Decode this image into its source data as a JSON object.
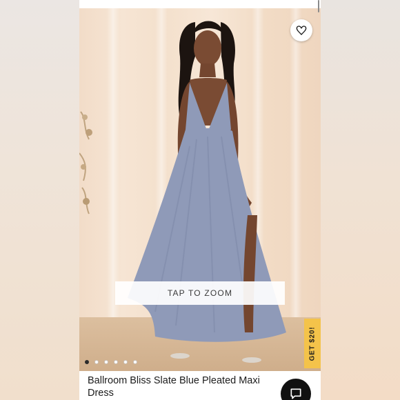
{
  "product": {
    "title": "Ballroom Bliss Slate Blue Pleated Maxi Dress",
    "image_alt": "Model wearing slate blue pleated maxi dress",
    "zoom_label": "TAP TO ZOOM",
    "promo_label": "GET $20!",
    "carousel": {
      "count": 6,
      "active_index": 0
    }
  },
  "icons": {
    "favorite": "heart-icon",
    "chat": "chat-icon"
  },
  "colors": {
    "dress": "#8f9ab8",
    "promo": "#f4c34a",
    "chat_button": "#111111",
    "active_dot": "#2b2b2b"
  }
}
